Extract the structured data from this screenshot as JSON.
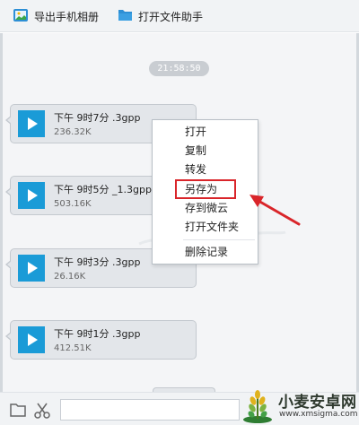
{
  "toolbar": {
    "export_album_label": "导出手机相册",
    "open_assistant_label": "打开文件助手"
  },
  "chat": {
    "timestamp": "21:58:50",
    "messages": [
      {
        "filename": "下午 9时7分 .3gpp",
        "size": "236.32K"
      },
      {
        "filename": "下午 9时5分 _1.3gpp",
        "size": "503.16K"
      },
      {
        "filename": "下午 9时3分 .3gpp",
        "size": "26.16K"
      },
      {
        "filename": "下午 9时1分 .3gpp",
        "size": "412.51K"
      }
    ]
  },
  "context_menu": {
    "items": [
      "打开",
      "复制",
      "转发",
      "另存为",
      "存到微云",
      "打开文件夹",
      "删除记录"
    ],
    "highlighted": "另存为"
  },
  "watermark": {
    "name": "小麦安卓网",
    "url": "www.xmsigma.com"
  },
  "colors": {
    "accent_blue": "#1a9bd7",
    "highlight_red": "#d9252a"
  }
}
